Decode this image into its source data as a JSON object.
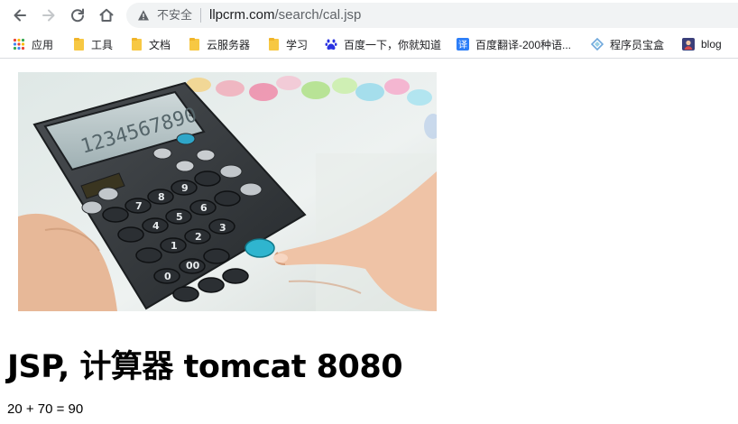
{
  "toolbar": {
    "security_label": "不安全",
    "url_host": "llpcrm.com",
    "url_path": "/search/cal.jsp"
  },
  "bookmarks": [
    {
      "label": "应用",
      "icon": "apps-grid-icon"
    },
    {
      "label": "工具",
      "icon": "folder-icon"
    },
    {
      "label": "文档",
      "icon": "folder-icon"
    },
    {
      "label": "云服务器",
      "icon": "folder-icon"
    },
    {
      "label": "学习",
      "icon": "folder-icon"
    },
    {
      "label": "百度一下，你就知道",
      "icon": "baidu-paw-icon"
    },
    {
      "label": "百度翻译-200种语...",
      "icon": "translate-icon"
    },
    {
      "label": "程序员宝盒",
      "icon": "diamond-icon"
    },
    {
      "label": "blog",
      "icon": "blog-avatar-icon"
    }
  ],
  "page": {
    "heading": "JSP, 计算器 tomcat 8080",
    "result": "20 + 70 = 90",
    "image": {
      "display": "1234567890"
    }
  },
  "colors": {
    "omnibox_bg": "#f1f3f4",
    "folder": "#f7c843",
    "calculator_body": "#2e3235",
    "display": "#b9c6c8"
  }
}
